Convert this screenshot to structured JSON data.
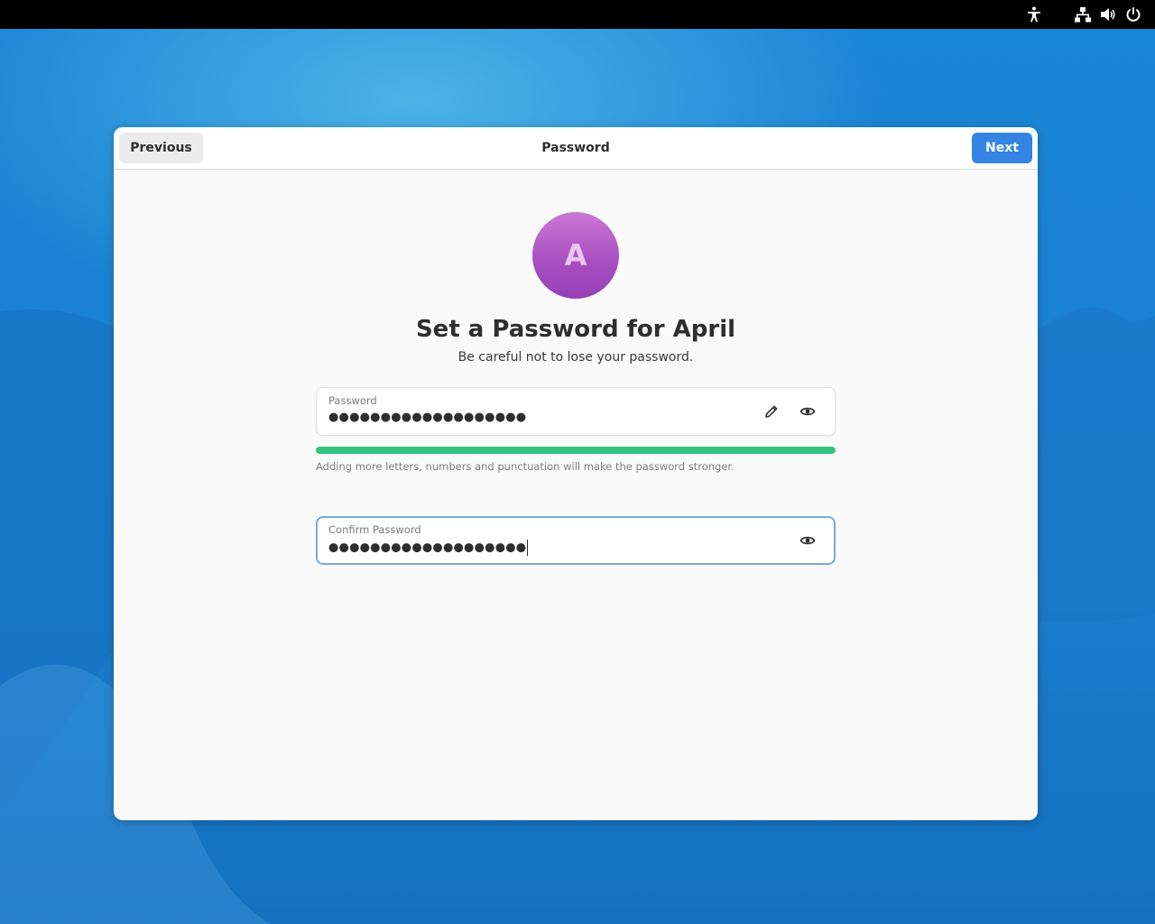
{
  "colors": {
    "accent": "#3584e4",
    "strength": "#33c27f",
    "avatar": "#a64ec0"
  },
  "topbar": {
    "icons": [
      "accessibility-icon",
      "network-wired-icon",
      "volume-icon",
      "power-icon"
    ]
  },
  "window": {
    "title": "Password",
    "previous_label": "Previous",
    "next_label": "Next"
  },
  "avatar": {
    "initial": "A"
  },
  "heading": "Set a Password for April",
  "subheading": "Be careful not to lose your password.",
  "password_field": {
    "label": "Password",
    "value": "●●●●●●●●●●●●●●●●●●●",
    "icons": [
      "edit-icon",
      "reveal-icon"
    ]
  },
  "strength": {
    "level": 1.0,
    "hint": "Adding more letters, numbers and punctuation will make the password stronger."
  },
  "confirm_field": {
    "label": "Confirm Password",
    "value": "●●●●●●●●●●●●●●●●●●●",
    "icons": [
      "reveal-icon"
    ]
  }
}
